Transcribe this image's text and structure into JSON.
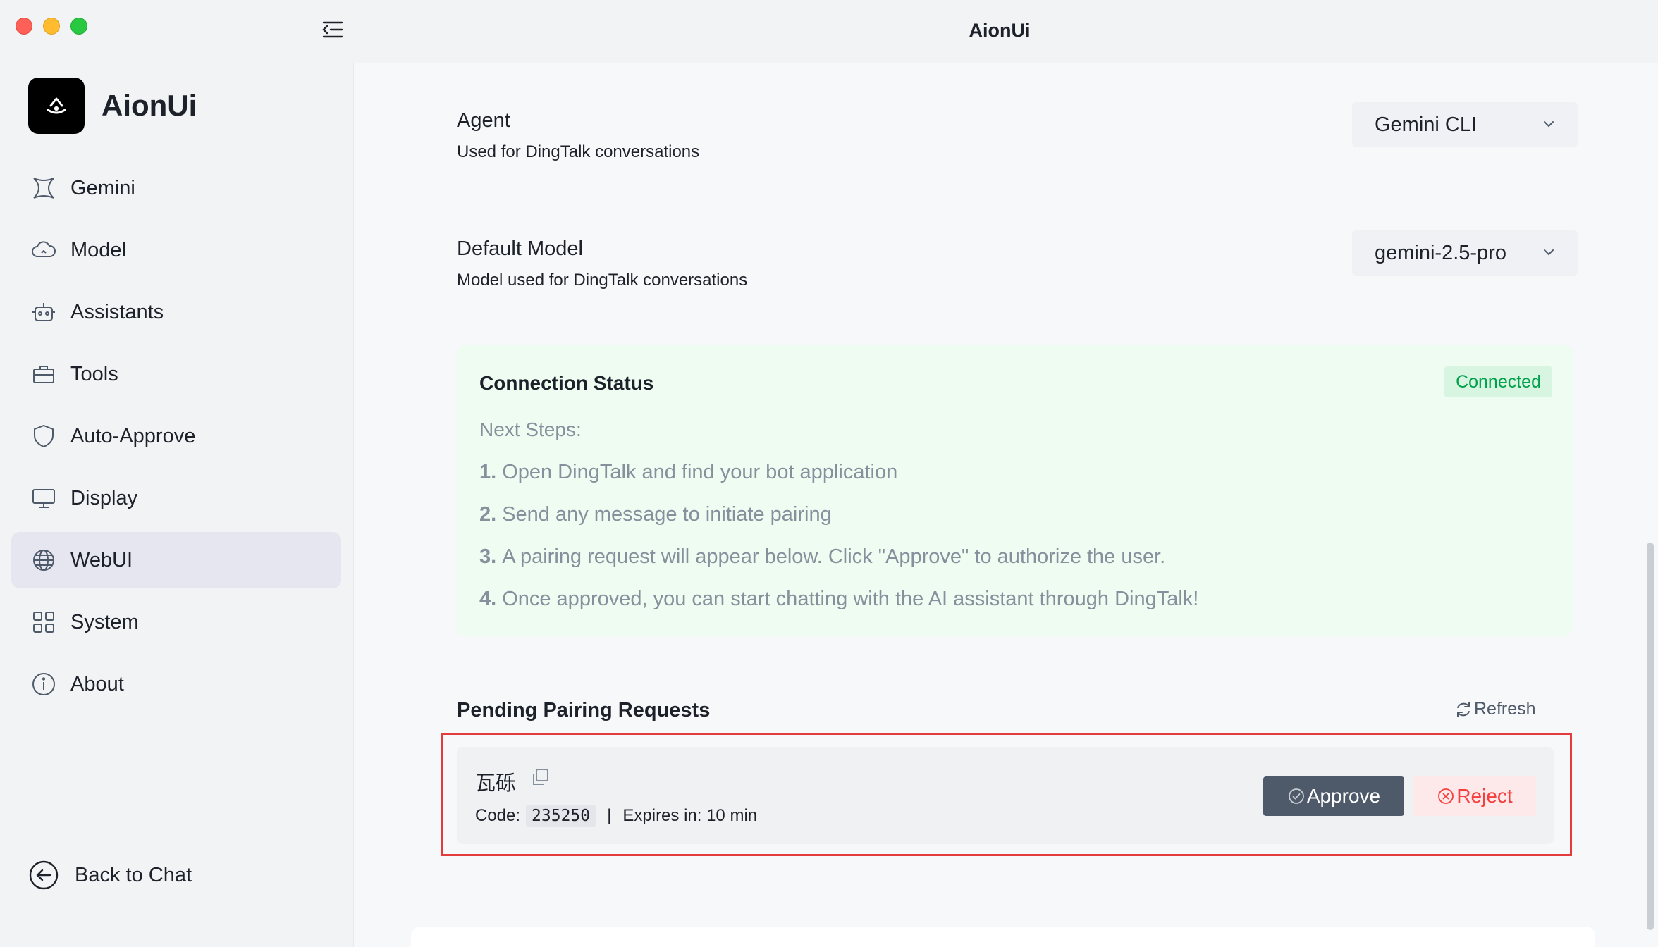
{
  "window": {
    "title": "AionUi"
  },
  "sidebar": {
    "brand": "AionUi",
    "items": [
      {
        "label": "Gemini",
        "icon": "gemini-icon"
      },
      {
        "label": "Model",
        "icon": "cloud-icon"
      },
      {
        "label": "Assistants",
        "icon": "robot-icon"
      },
      {
        "label": "Tools",
        "icon": "toolbox-icon"
      },
      {
        "label": "Auto-Approve",
        "icon": "shield-icon"
      },
      {
        "label": "Display",
        "icon": "monitor-icon"
      },
      {
        "label": "WebUI",
        "icon": "globe-icon",
        "active": true
      },
      {
        "label": "System",
        "icon": "grid-icon"
      },
      {
        "label": "About",
        "icon": "info-icon"
      }
    ],
    "back_to_chat": "Back to Chat"
  },
  "settings": {
    "agent": {
      "title": "Agent",
      "desc": "Used for DingTalk conversations",
      "value": "Gemini CLI"
    },
    "model": {
      "title": "Default Model",
      "desc": "Model used for DingTalk conversations",
      "value": "gemini-2.5-pro"
    }
  },
  "connection": {
    "title": "Connection Status",
    "badge": "Connected",
    "next_steps_label": "Next Steps:",
    "steps": [
      {
        "num": "1.",
        "text": "Open DingTalk and find your bot application"
      },
      {
        "num": "2.",
        "text": "Send any message to initiate pairing"
      },
      {
        "num": "3.",
        "text": "A pairing request will appear below. Click \"Approve\" to authorize the user."
      },
      {
        "num": "4.",
        "text": "Once approved, you can start chatting with the AI assistant through DingTalk!"
      }
    ]
  },
  "pending": {
    "title": "Pending Pairing Requests",
    "refresh": "Refresh",
    "request": {
      "name": "瓦砾",
      "code_label": "Code:",
      "code": "235250",
      "separator": "|",
      "expires": "Expires in: 10 min",
      "approve": "Approve",
      "reject": "Reject"
    }
  },
  "colors": {
    "accent_active": "#e5e6f0",
    "connected_green": "#00a14b",
    "connected_bg": "#eefcf2",
    "approve_bg": "#4e5969",
    "reject_red": "#f53f3f",
    "highlight_red": "#e43c3c"
  }
}
